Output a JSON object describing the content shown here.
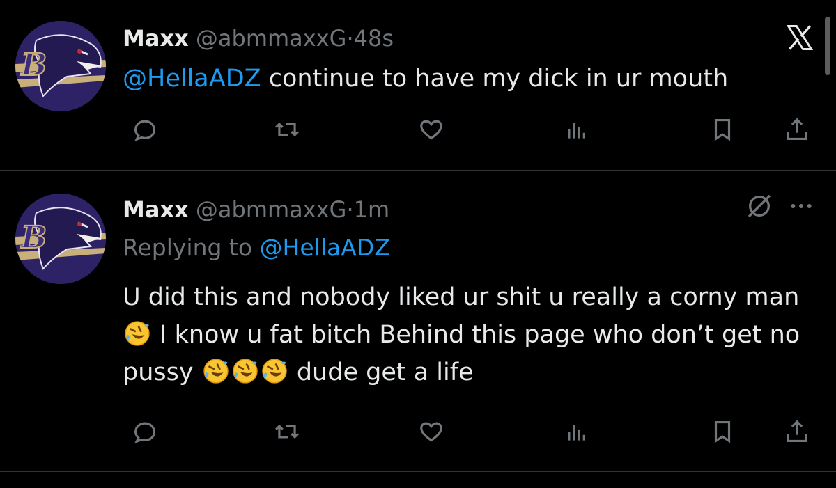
{
  "tweets": [
    {
      "name": "Maxx",
      "handle": "@abmmaxxG",
      "separator": "·",
      "time": "48s",
      "mention": "@HellaADZ",
      "text": " continue to have my dick in ur mouth"
    },
    {
      "name": "Maxx",
      "handle": "@abmmaxxG",
      "separator": "·",
      "time": "1m",
      "replying_prefix": "Replying to ",
      "replying_to": "@HellaADZ",
      "text_part1": "U did this and nobody liked ur shit u really a corny man ",
      "text_part2": " I know u fat bitch Behind this page who don’t get no pussy ",
      "text_part3": " dude get a life"
    }
  ],
  "icons": {
    "reply": "reply-icon",
    "retweet": "retweet-icon",
    "like": "heart-icon",
    "views": "views-icon",
    "bookmark": "bookmark-icon",
    "share": "share-icon",
    "close": "x-logo-icon",
    "grok": "grok-icon",
    "more": "more-icon",
    "emoji": "rofl-emoji-icon"
  },
  "colors": {
    "background": "#000000",
    "text": "#e7e9ea",
    "muted": "#71767b",
    "link": "#1d9bf0",
    "divider": "#2f3336",
    "avatar": "#3b2d7a"
  }
}
